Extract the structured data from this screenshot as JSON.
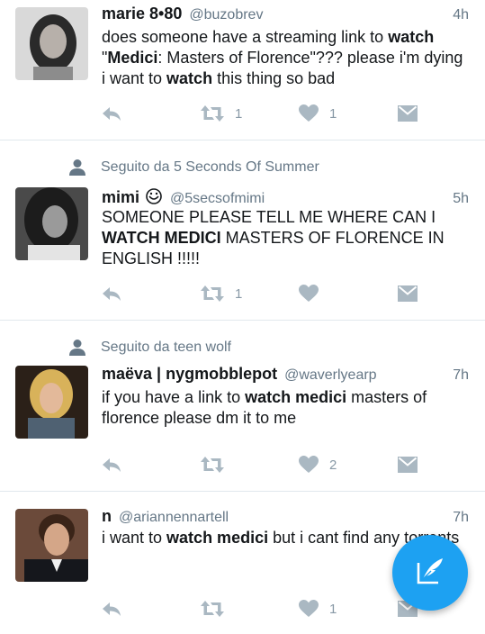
{
  "tweets": [
    {
      "context": "",
      "name": "marie 8•80",
      "handle": "@buzobrev",
      "time": "4h",
      "text_parts": [
        {
          "t": "does someone have a streaming link to ",
          "b": false
        },
        {
          "t": "watch",
          "b": true
        },
        {
          "t": " \"",
          "b": false
        },
        {
          "t": "Medici",
          "b": true
        },
        {
          "t": ": Masters of Florence\"??? please i'm dying i want to ",
          "b": false
        },
        {
          "t": "watch",
          "b": true
        },
        {
          "t": " this thing so bad",
          "b": false
        }
      ],
      "retweets": "1",
      "likes": "1"
    },
    {
      "context": "Seguito da 5 Seconds Of Summer",
      "name": "mimi",
      "handle": "@5secsofmimi",
      "time": "5h",
      "text_parts": [
        {
          "t": "SOMEONE PLEASE TELL ME WHERE CAN I ",
          "b": false
        },
        {
          "t": "WATCH MEDICI",
          "b": true
        },
        {
          "t": " MASTERS OF FLORENCE IN ENGLISH !!!!!",
          "b": false
        }
      ],
      "retweets": "1",
      "likes": ""
    },
    {
      "context": "Seguito da teen wolf",
      "name": "maëva | nygmobblepot",
      "handle": "@waverlyearp",
      "time": "7h",
      "text_parts": [
        {
          "t": "if you have a link to ",
          "b": false
        },
        {
          "t": "watch medici",
          "b": true
        },
        {
          "t": " masters of florence please dm it to me",
          "b": false
        }
      ],
      "retweets": "",
      "likes": "2"
    },
    {
      "context": "",
      "name": "n",
      "handle": "@ariannennartell",
      "time": "7h",
      "text_parts": [
        {
          "t": "i want to ",
          "b": false
        },
        {
          "t": "watch medici",
          "b": true
        },
        {
          "t": " but i cant find any torrents",
          "b": false
        }
      ],
      "retweets": "",
      "likes": "1"
    }
  ],
  "icons": {
    "reply": "reply-icon",
    "retweet": "retweet-icon",
    "like": "heart-icon",
    "dm": "envelope-icon",
    "follow_context": "person-icon",
    "compose": "compose-feather-icon"
  },
  "colors": {
    "accent": "#1da1f2",
    "secondary_text": "#657786",
    "action_icon": "#aab8c2",
    "divider": "#e1e8ed"
  }
}
